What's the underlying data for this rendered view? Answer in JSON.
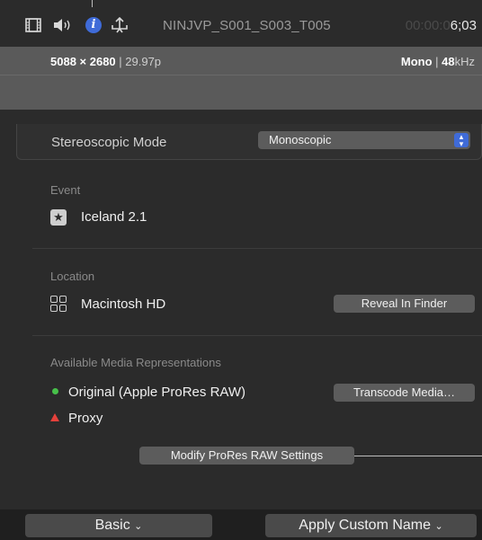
{
  "header": {
    "clip_name": "NINJVP_S001_S003_T005",
    "timecode_dim": "00:00:0",
    "timecode_bright": "6;03"
  },
  "info_band": {
    "resolution_bold": "5088 × 2680",
    "frame_rate": "29.97p",
    "audio_channels": "Mono",
    "sample_rate_bold": "48",
    "sample_rate_unit": "kHz"
  },
  "stereoscopic": {
    "label": "Stereoscopic Mode",
    "value": "Monoscopic"
  },
  "event": {
    "section_label": "Event",
    "name": "Iceland 2.1"
  },
  "location": {
    "section_label": "Location",
    "name": "Macintosh HD",
    "reveal_button": "Reveal In Finder"
  },
  "media": {
    "section_label": "Available Media Representations",
    "original": "Original (Apple ProRes RAW)",
    "proxy": "Proxy",
    "transcode_button": "Transcode Media…",
    "modify_button": "Modify ProRes RAW Settings"
  },
  "bottom_bar": {
    "basic_label": "Basic",
    "apply_label": "Apply Custom Name"
  },
  "colors": {
    "accent_blue": "#3f6bd8",
    "status_green": "#47c04a",
    "status_red": "#e5413b"
  },
  "icons": [
    "film-icon",
    "speaker-icon",
    "info-icon",
    "share-icon",
    "star-icon",
    "drive-icon",
    "chevron-down-icon"
  ]
}
